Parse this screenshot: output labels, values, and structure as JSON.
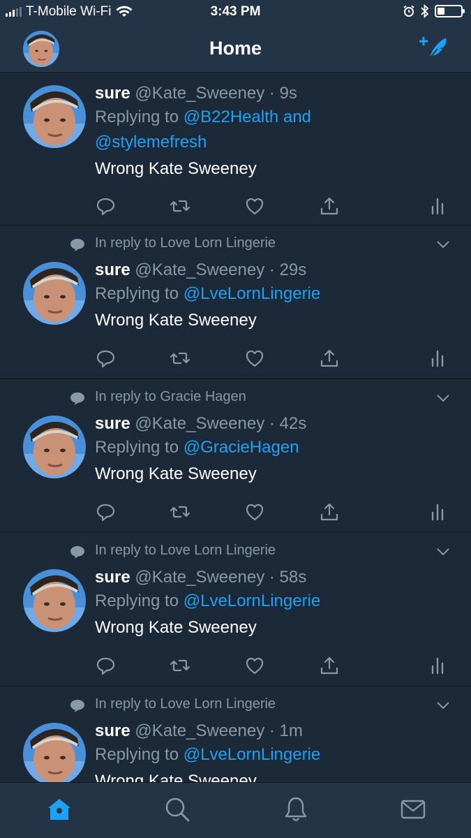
{
  "status_bar": {
    "carrier": "T-Mobile Wi-Fi",
    "time": "3:43 PM",
    "battery_level": 0.3
  },
  "header": {
    "title": "Home"
  },
  "tweets": [
    {
      "partial_top": true,
      "reply_context": "",
      "name": "sure",
      "handle": "@Kate_Sweeney",
      "time": "· 9s",
      "replying_prefix": "Replying to",
      "replying_line1": "@B22Health and",
      "replying_line2": "@stylemefresh",
      "text": "Wrong Kate Sweeney"
    },
    {
      "reply_context": "In reply to Love Lorn Lingerie",
      "name": "sure",
      "handle": "@Kate_Sweeney",
      "time": "· 29s",
      "replying_prefix": "Replying to",
      "replying_to": "@LveLornLingerie",
      "text": "Wrong Kate Sweeney"
    },
    {
      "reply_context": "In reply to Gracie Hagen",
      "name": "sure",
      "handle": "@Kate_Sweeney",
      "time": "· 42s",
      "replying_prefix": "Replying to",
      "replying_to": "@GracieHagen",
      "text": "Wrong Kate Sweeney"
    },
    {
      "reply_context": "In reply to Love Lorn Lingerie",
      "name": "sure",
      "handle": "@Kate_Sweeney",
      "time": "· 58s",
      "replying_prefix": "Replying to",
      "replying_to": "@LveLornLingerie",
      "text": "Wrong Kate Sweeney"
    },
    {
      "reply_context": "In reply to Love Lorn Lingerie",
      "name": "sure",
      "handle": "@Kate_Sweeney",
      "time": "· 1m",
      "replying_prefix": "Replying to",
      "replying_to": "@LveLornLingerie",
      "text": "Wrong Kate Sweeney"
    }
  ],
  "tab_bar": {
    "tabs": [
      "home-icon",
      "search-icon",
      "bell-icon",
      "mail-icon"
    ],
    "active": "home-icon"
  },
  "colors": {
    "background": "#1c2938",
    "bar": "#243447",
    "accent": "#1da1f2",
    "muted": "#8899a6"
  }
}
